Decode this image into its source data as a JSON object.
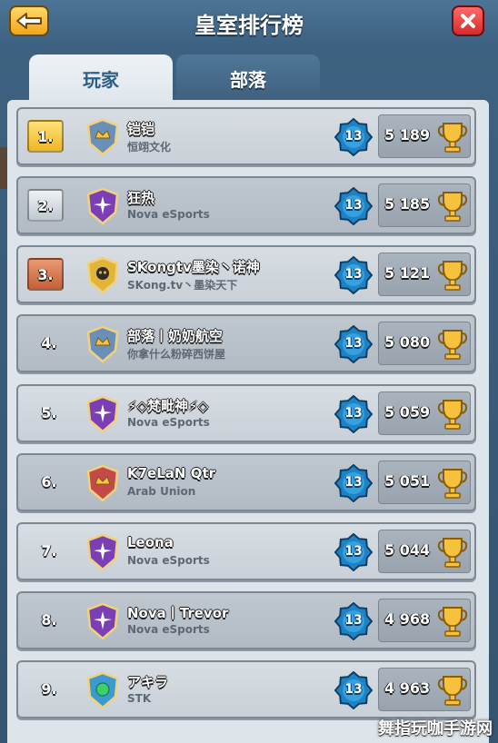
{
  "header": {
    "title": "皇室排行榜"
  },
  "tabs": [
    {
      "label": "玩家",
      "active": true
    },
    {
      "label": "部落",
      "active": false
    }
  ],
  "colors": {
    "accent_gold": "#f0b624",
    "close_red": "#d62a2a",
    "level_blue": "#1f82c4"
  },
  "players": [
    {
      "rank": "1.",
      "name": "铠铠",
      "clan": "恒翊文化",
      "level": "13",
      "trophies": "5 189",
      "badge": "gold",
      "clan_icon": "crown-shield-icon"
    },
    {
      "rank": "2.",
      "name": "狂热",
      "clan": "Nova eSports",
      "level": "13",
      "trophies": "5 185",
      "badge": "silver",
      "clan_icon": "purple-star-shield-icon"
    },
    {
      "rank": "3.",
      "name": "SKongtv墨染丶诺神",
      "clan": "SKong.tv丶墨染天下",
      "level": "13",
      "trophies": "5 121",
      "badge": "bronze",
      "clan_icon": "skull-shield-icon"
    },
    {
      "rank": "4.",
      "name": "部落丨奶奶航空",
      "clan": "你拿什么粉碎西饼屋",
      "level": "13",
      "trophies": "5 080",
      "badge": "plain",
      "clan_icon": "crown-shield-icon"
    },
    {
      "rank": "5.",
      "name": "⚡◇梵毗神⚡◇",
      "clan": "Nova eSports",
      "level": "13",
      "trophies": "5 059",
      "badge": "plain",
      "clan_icon": "purple-star-shield-icon"
    },
    {
      "rank": "6.",
      "name": "K7eLaN Qtr",
      "clan": "Arab Union",
      "level": "13",
      "trophies": "5 051",
      "badge": "plain",
      "clan_icon": "royal-shield-icon"
    },
    {
      "rank": "7.",
      "name": "Leona",
      "clan": "Nova eSports",
      "level": "13",
      "trophies": "5 044",
      "badge": "plain",
      "clan_icon": "purple-star-shield-icon"
    },
    {
      "rank": "8.",
      "name": "Nova丨Trevor",
      "clan": "Nova eSports",
      "level": "13",
      "trophies": "4 968",
      "badge": "plain",
      "clan_icon": "purple-star-shield-icon"
    },
    {
      "rank": "9.",
      "name": "アキラ",
      "clan": "STK",
      "level": "13",
      "trophies": "4 963",
      "badge": "plain",
      "clan_icon": "green-gem-shield-icon"
    }
  ],
  "watermark": "舞指玩咖手游网"
}
